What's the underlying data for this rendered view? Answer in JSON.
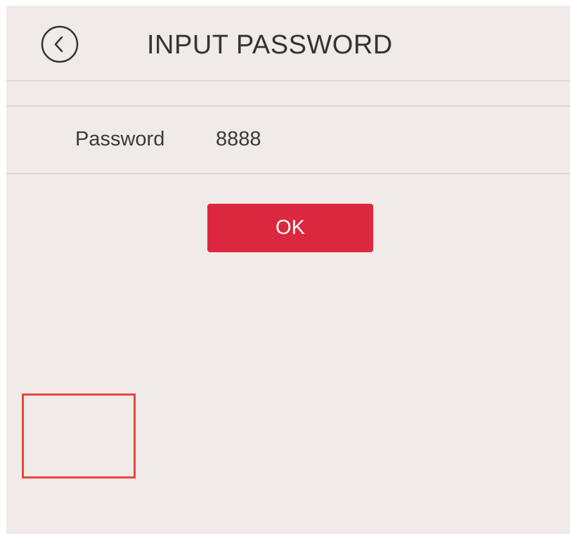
{
  "header": {
    "back_icon": "chevron-left-circle-icon",
    "title": "INPUT PASSWORD"
  },
  "form": {
    "password_label": "Password",
    "password_value": "8888"
  },
  "actions": {
    "ok_label": "OK"
  },
  "colors": {
    "background": "#f0ebe9",
    "divider": "#dcd6d4",
    "ok_button": "#dc283e",
    "ok_text": "#ffffff",
    "highlight_border": "#e8473a",
    "text": "#333333"
  }
}
